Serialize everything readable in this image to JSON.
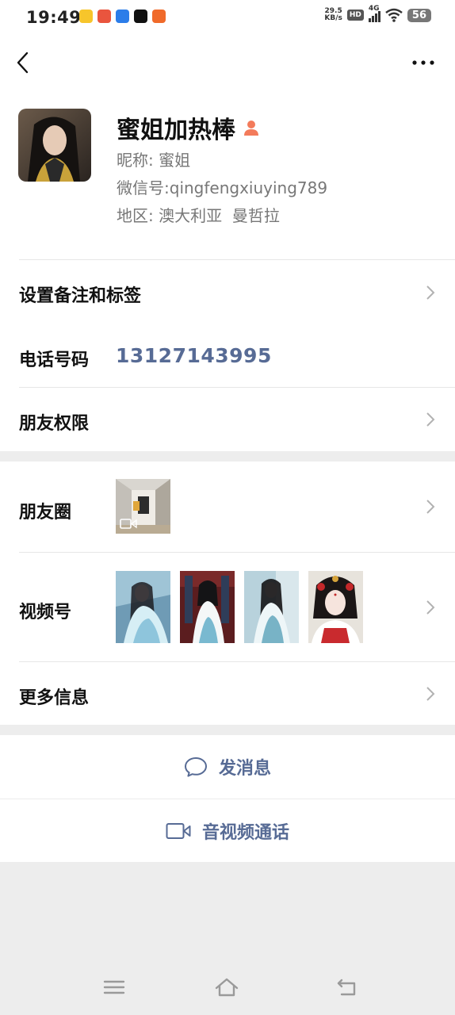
{
  "status_bar": {
    "time": "19:49",
    "net_speed_value": "29.5",
    "net_speed_unit": "KB/s",
    "hd": "HD",
    "signal": "4G",
    "battery": "56"
  },
  "profile": {
    "remark_name": "蜜姐加热棒",
    "nickname_label": "昵称:",
    "nickname": "蜜姐",
    "wechat_id_label": "微信号:",
    "wechat_id": "qingfengxiuying789",
    "region_label": "地区:",
    "region": "澳大利亚  曼哲拉",
    "gender_icon": "female-icon"
  },
  "rows": {
    "set_remark_label": "设置备注和标签",
    "phone_label": "电话号码",
    "phone_value": "13127143995",
    "permissions_label": "朋友权限",
    "moments_label": "朋友圈",
    "channels_label": "视频号",
    "more_info_label": "更多信息"
  },
  "actions": {
    "send_message": "发消息",
    "video_call": "音视频通话"
  },
  "colors": {
    "link_blue": "#576b95",
    "background": "#ededed",
    "card": "#ffffff",
    "gender_accent": "#f37b5b"
  }
}
